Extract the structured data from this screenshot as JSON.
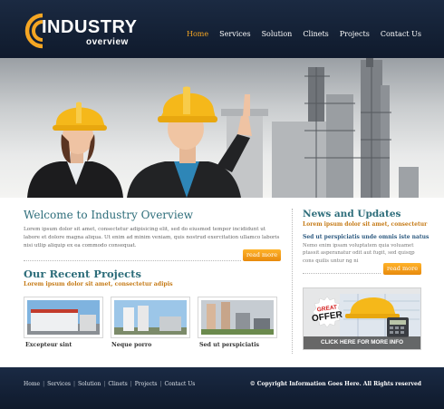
{
  "brand": {
    "logo_word": "INDUSTRY",
    "logo_sub": "overview",
    "accent": "#f5a623",
    "header_bg": "#1b2a42",
    "heading_color": "#2d6d7a"
  },
  "nav": {
    "items": [
      {
        "label": "Home",
        "active": true
      },
      {
        "label": "Services",
        "active": false
      },
      {
        "label": "Solution",
        "active": false
      },
      {
        "label": "Clinets",
        "active": false
      },
      {
        "label": "Projects",
        "active": false
      },
      {
        "label": "Contact Us",
        "active": false
      }
    ]
  },
  "welcome": {
    "title": "Welcome to Industry Overview",
    "text": "Lorem ipsum dolor sit amet, consectetur adipisicing elit, sed do eiusmod tempor incididunt ut labore et dolore magna aliqua. Ut enim ad minim veniam, quis nostrud exercitation ullamco laboris nisi utlip aliquip ex ea commodo consequat.",
    "button": "read more"
  },
  "projects": {
    "title": "Our Recent Projects",
    "subtitle": "Lorem ipsum dolor sit amet, consectetur adipis",
    "items": [
      {
        "caption": "Excepteur sint"
      },
      {
        "caption": "Neque porro"
      },
      {
        "caption": "Sed ut perspiciatis"
      }
    ]
  },
  "news": {
    "title": "News and Updates",
    "subtitle": "Lorem ipsum dolor sit amet, consectetur",
    "item_title": "Sed ut perspiciatis unde omnis iste natus",
    "item_text": "Nemo enim ipsam voluptatem quia voluamet ptassit asperanatur odit aut fugit, sed quisqp cons quilis untur ng ni",
    "button": "read more"
  },
  "offer": {
    "badge_top": "GREAT",
    "badge_word": "OFFER",
    "cta": "CLICK HERE FOR MORE INFO"
  },
  "footer": {
    "links": [
      "Home",
      "Services",
      "Solution",
      "Clinets",
      "Projects",
      "Contact Us"
    ],
    "copyright": "© Copyright Information Goes Here. All Rights reserved"
  }
}
